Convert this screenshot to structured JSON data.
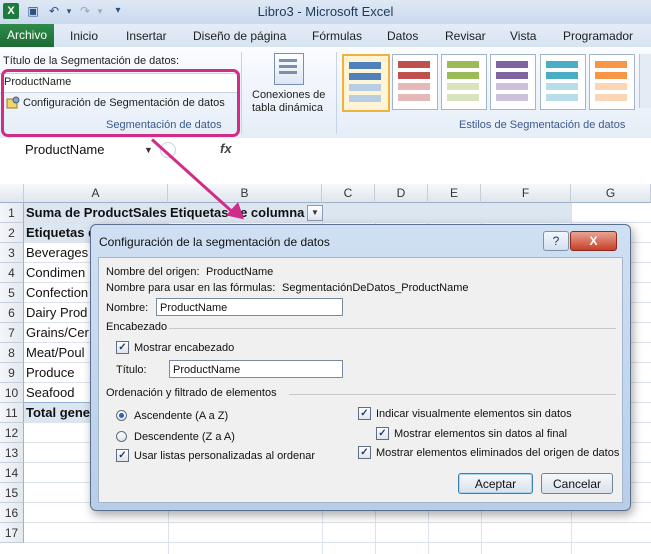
{
  "window": {
    "title": "Libro3 - Microsoft Excel",
    "app_icon": "X"
  },
  "ribbon_tabs": [
    "Archivo",
    "Inicio",
    "Insertar",
    "Diseño de página",
    "Fórmulas",
    "Datos",
    "Revisar",
    "Vista",
    "Programador"
  ],
  "ribbon": {
    "caption_label": "Título de la Segmentación de datos:",
    "caption_value": "ProductName",
    "settings_button": "Configuración de Segmentación de datos",
    "group_segmentacion": "Segmentación de datos",
    "conn_button_line1": "Conexiones de",
    "conn_button_line2": "tabla dinámica",
    "group_styles": "Estilos de Segmentación de datos"
  },
  "namebox": {
    "value": "ProductName",
    "fx": "fx"
  },
  "columns": [
    "A",
    "B",
    "C",
    "D",
    "E",
    "F",
    "G"
  ],
  "rows": [
    "1",
    "2",
    "3",
    "4",
    "5",
    "6",
    "7",
    "8",
    "9",
    "10",
    "11",
    "12",
    "13",
    "14",
    "15",
    "16",
    "17"
  ],
  "cells": {
    "r1a": "Suma de ProductSales",
    "r1b": "Etiquetas de columna",
    "r2a": "Etiquetas d",
    "r3a": "Beverages",
    "r4a": "Condimen",
    "r5a": "Confection",
    "r6a": "Dairy Prod",
    "r7a": "Grains/Cer",
    "r8a": "Meat/Poul",
    "r9a": "Produce",
    "r10a": "Seafood",
    "r11a": "Total gene"
  },
  "dialog": {
    "title": "Configuración de la segmentación de datos",
    "help": "?",
    "close": "X",
    "source_label": "Nombre del origen:",
    "source_value": "ProductName",
    "formula_label": "Nombre para usar en las fórmulas:",
    "formula_value": "SegmentaciónDeDatos_ProductName",
    "name_label": "Nombre:",
    "name_value": "ProductName",
    "header_group": "Encabezado",
    "show_header": "Mostrar encabezado",
    "show_header_checked": true,
    "title_label": "Título:",
    "title_value": "ProductName",
    "sort_group": "Ordenación y filtrado de elementos",
    "asc": "Ascendente (A a Z)",
    "desc": "Descendente (Z a A)",
    "custom_lists": "Usar listas personalizadas al ordenar",
    "indicate_empty": "Indicar visualmente elementos sin datos",
    "show_empty_last": "Mostrar elementos sin datos al final",
    "show_deleted": "Mostrar elementos eliminados del origen de datos",
    "ok": "Aceptar",
    "cancel": "Cancelar"
  },
  "colors": {
    "highlight": "#d12d88",
    "file_tab": "#1d6b34",
    "dialog_frame": "#b8cee8"
  }
}
